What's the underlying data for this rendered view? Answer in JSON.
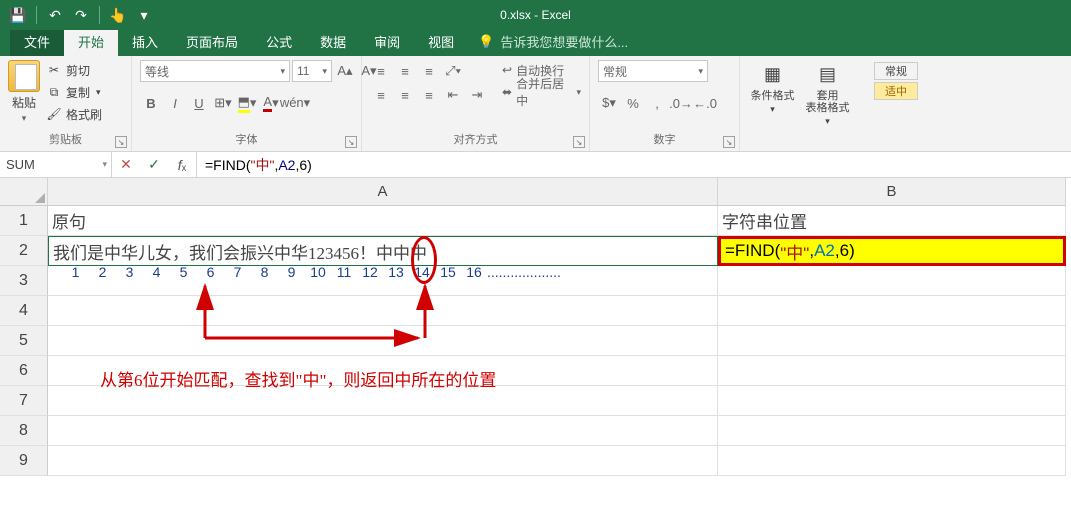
{
  "titlebar": {
    "title": "0.xlsx - Excel"
  },
  "qat": {
    "save": "💾",
    "undo": "↶",
    "redo": "↷",
    "touch": "👆"
  },
  "tabs": {
    "file": "文件",
    "home": "开始",
    "insert": "插入",
    "layout": "页面布局",
    "formulas": "公式",
    "data": "数据",
    "review": "审阅",
    "view": "视图",
    "tellme": "告诉我您想要做什么..."
  },
  "ribbon": {
    "clipboard": {
      "paste": "粘贴",
      "cut": "剪切",
      "copy": "复制",
      "painter": "格式刷",
      "label": "剪贴板"
    },
    "font": {
      "name": "等线",
      "size": "11",
      "label": "字体",
      "bold": "B",
      "italic": "I",
      "underline": "U"
    },
    "align": {
      "wrap": "自动换行",
      "merge": "合并后居中",
      "label": "对齐方式"
    },
    "number": {
      "fmt": "常规",
      "label": "数字"
    },
    "styles": {
      "cond": "条件格式",
      "table": "套用\n表格格式"
    },
    "cellstyles": {
      "normal": "常规",
      "neutral": "适中"
    }
  },
  "namebox": "SUM",
  "formula_parts": {
    "pre": "=FIND(",
    "str": "\"中\"",
    "c1": ",",
    "ref": "A2",
    "c2": ",",
    "num": "6",
    "post": ")"
  },
  "headers": {
    "A": "A",
    "B": "B"
  },
  "rows": {
    "r1": {
      "a": "原句",
      "b": "字符串位置"
    },
    "r2": {
      "a": "我们是中华儿女，我们会振兴中华123456！中中中"
    },
    "formula_b2": {
      "pre": "=FIND(",
      "str": "\"中\"",
      "c1": ",",
      "ref": "A2",
      "c2": ",",
      "num": "6",
      "post": ")"
    }
  },
  "anno": {
    "numbers": [
      "1",
      "2",
      "3",
      "4",
      "5",
      "6",
      "7",
      "8",
      "9",
      "10",
      "11",
      "12",
      "13",
      "14",
      "15",
      "16",
      "..................."
    ],
    "explain": "从第6位开始匹配，查找到\"中\"，则返回中所在的位置"
  },
  "chart_data": null
}
